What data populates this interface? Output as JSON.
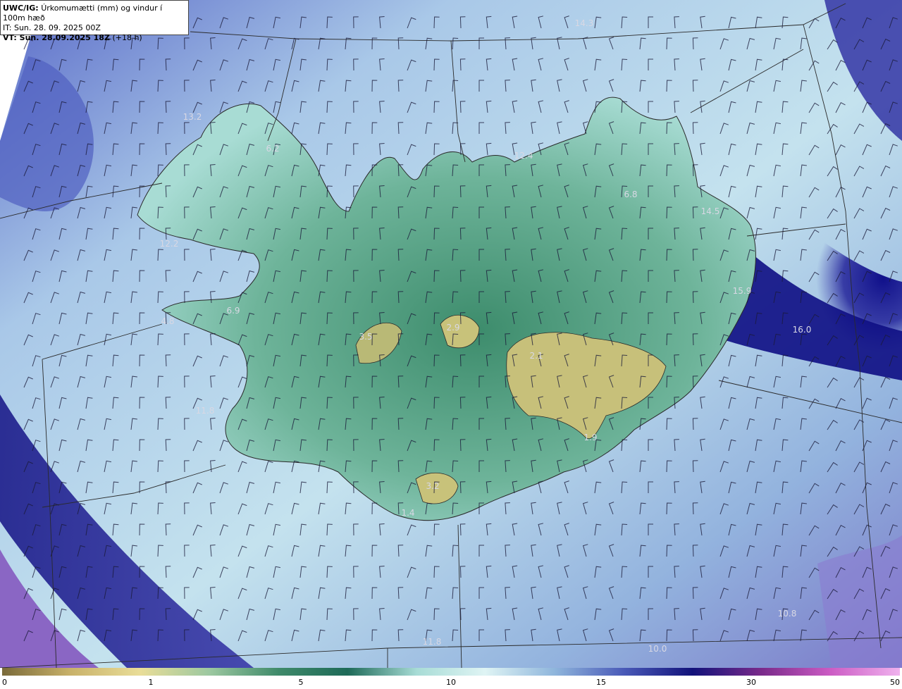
{
  "header": {
    "model": "UWC/IG:",
    "title": "Úrkomumætti (mm) og vindur í 100m hæð",
    "init_time": "IT: Sun. 28. 09. 2025 00Z",
    "valid_time_label": "VT: Sun. 28.09.2025 18Z",
    "lead": "(+18 h)"
  },
  "values": [
    {
      "id": "nw-sea",
      "text": "13.2"
    },
    {
      "id": "westfjords",
      "text": "6.2"
    },
    {
      "id": "west-coast",
      "text": "12.2"
    },
    {
      "id": "snaefellsnes",
      "text": "6.9"
    },
    {
      "id": "snaefellsnes-tip",
      "text": "4.8"
    },
    {
      "id": "langjokull",
      "text": "3.5"
    },
    {
      "id": "hofsjokull",
      "text": "2.9"
    },
    {
      "id": "vatnajokull",
      "text": "2.1"
    },
    {
      "id": "vatnajokull-south",
      "text": "1.9"
    },
    {
      "id": "myrdalsjokull",
      "text": "3.2"
    },
    {
      "id": "south-coast",
      "text": "1.4"
    },
    {
      "id": "north",
      "text": "12.4"
    },
    {
      "id": "north-sea",
      "text": "14.3"
    },
    {
      "id": "northeast",
      "text": "6.8"
    },
    {
      "id": "east-fjords",
      "text": "14.5"
    },
    {
      "id": "east-coast",
      "text": "15.9"
    },
    {
      "id": "east-sea",
      "text": "16.0"
    },
    {
      "id": "sw-sea",
      "text": "11.8"
    },
    {
      "id": "south-sea",
      "text": "11.8"
    },
    {
      "id": "se-sea",
      "text": "10.8"
    },
    {
      "id": "south-sea-2",
      "text": "10.0"
    }
  ],
  "legend": {
    "ticks": [
      "0",
      "1",
      "5",
      "10",
      "15",
      "30",
      "50"
    ],
    "colors": [
      "#7a6a3a",
      "#c9b26a",
      "#e9dd98",
      "#9cc8a0",
      "#3f8a6a",
      "#1e6a58",
      "#a8dcd6",
      "#dff4f4",
      "#8fb6dc",
      "#4a5ab8",
      "#12127a",
      "#7a2a8a",
      "#cc5cc4",
      "#f0b2ee"
    ]
  },
  "colors": {
    "sea_light": "#b8d9ec",
    "sea_dark": "#1e1e8c",
    "land_green": "#5da88a",
    "glacier": "#c8c27a",
    "border": "#2a2a2a"
  }
}
